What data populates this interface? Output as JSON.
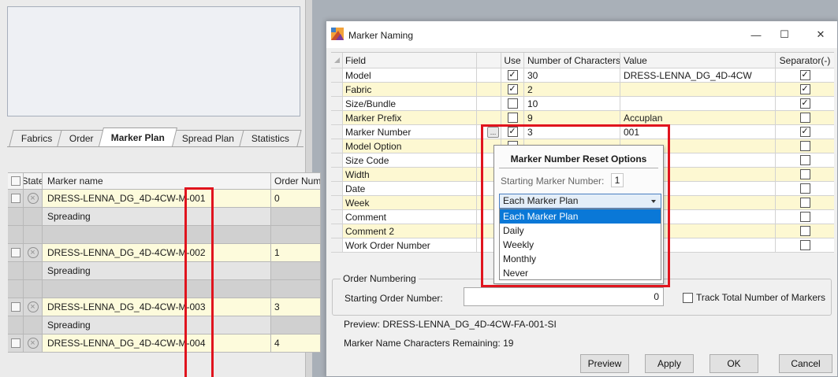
{
  "background_app": {
    "tabs": [
      {
        "label": "Fabrics",
        "active": false
      },
      {
        "label": "Order",
        "active": false
      },
      {
        "label": "Marker Plan",
        "active": true
      },
      {
        "label": "Spread Plan",
        "active": false
      },
      {
        "label": "Statistics",
        "active": false
      }
    ],
    "grid": {
      "headers": {
        "state": "State",
        "marker_name": "Marker name",
        "order_num": "Order Num."
      },
      "rows": [
        {
          "type": "marker",
          "name": "DRESS-LENNA_DG_4D-4CW-M-001",
          "order": "0"
        },
        {
          "type": "spread",
          "name": "Spreading",
          "order": ""
        },
        {
          "type": "blank",
          "name": "",
          "order": ""
        },
        {
          "type": "marker",
          "name": "DRESS-LENNA_DG_4D-4CW-M-002",
          "order": "1"
        },
        {
          "type": "spread",
          "name": "Spreading",
          "order": ""
        },
        {
          "type": "blank",
          "name": "",
          "order": ""
        },
        {
          "type": "marker",
          "name": "DRESS-LENNA_DG_4D-4CW-M-003",
          "order": "3"
        },
        {
          "type": "spread",
          "name": "Spreading",
          "order": ""
        },
        {
          "type": "marker",
          "name": "DRESS-LENNA_DG_4D-4CW-M-004",
          "order": "4"
        }
      ]
    }
  },
  "dialog": {
    "title": "Marker Naming",
    "window_buttons": {
      "minimize": "—",
      "maximize": "☐",
      "close": "✕"
    },
    "table": {
      "headers": {
        "field": "Field",
        "use": "Use",
        "num_chars": "Number of Characters",
        "value": "Value",
        "separator": "Separator(-)"
      },
      "rows": [
        {
          "field": "Model",
          "use": true,
          "chars": "30",
          "value": "DRESS-LENNA_DG_4D-4CW",
          "sep": true,
          "highlight": false
        },
        {
          "field": "Fabric",
          "use": true,
          "chars": "2",
          "value": "",
          "sep": true,
          "highlight": true
        },
        {
          "field": "Size/Bundle",
          "use": false,
          "chars": "10",
          "value": "",
          "sep": true,
          "highlight": false
        },
        {
          "field": "Marker Prefix",
          "use": false,
          "chars": "9",
          "value": "Accuplan",
          "sep": false,
          "highlight": true
        },
        {
          "field": "Marker Number",
          "use": true,
          "chars": "3",
          "value": "001",
          "sep": true,
          "highlight": false,
          "has_button": true
        },
        {
          "field": "Model Option",
          "use": false,
          "chars": "",
          "value": "",
          "sep": false,
          "highlight": true
        },
        {
          "field": "Size Code",
          "use": false,
          "chars": "",
          "value": "",
          "sep": false,
          "highlight": false
        },
        {
          "field": "Width",
          "use": false,
          "chars": "",
          "value": "",
          "sep": false,
          "highlight": true
        },
        {
          "field": "Date",
          "use": false,
          "chars": "",
          "value": "",
          "sep": false,
          "highlight": false
        },
        {
          "field": "Week",
          "use": false,
          "chars": "",
          "value": "",
          "sep": false,
          "highlight": true
        },
        {
          "field": "Comment",
          "use": false,
          "chars": "",
          "value": "",
          "sep": false,
          "highlight": false
        },
        {
          "field": "Comment 2",
          "use": false,
          "chars": "",
          "value": "",
          "sep": false,
          "highlight": true
        },
        {
          "field": "Work Order Number",
          "use": false,
          "chars": "",
          "value": "",
          "sep": false,
          "highlight": false
        }
      ]
    },
    "order_numbering": {
      "legend": "Order Numbering",
      "label": "Starting Order Number:",
      "value": "0",
      "track_label": "Track Total Number of Markers",
      "track_checked": false
    },
    "preview_text": "Preview:  DRESS-LENNA_DG_4D-4CW-FA-001-SI",
    "remaining_text": "Marker Name Characters Remaining: 19",
    "buttons": {
      "preview": "Preview",
      "apply": "Apply",
      "ok": "OK",
      "cancel": "Cancel"
    }
  },
  "reset_popup": {
    "title": "Marker Number Reset Options",
    "start_label": "Starting Marker Number:",
    "start_value": "1",
    "selected": "Each Marker Plan",
    "options": [
      "Each Marker Plan",
      "Daily",
      "Weekly",
      "Monthly",
      "Never"
    ]
  },
  "colors": {
    "highlight_row": "#fdf8d2",
    "marker_cell": "#fdfbdc",
    "annotation_red": "#e0141e",
    "selection_blue": "#0a78d7"
  },
  "icons": {
    "state": "circle-x-icon",
    "check": "checkmark-icon",
    "app": "marker-naming-app-icon"
  }
}
